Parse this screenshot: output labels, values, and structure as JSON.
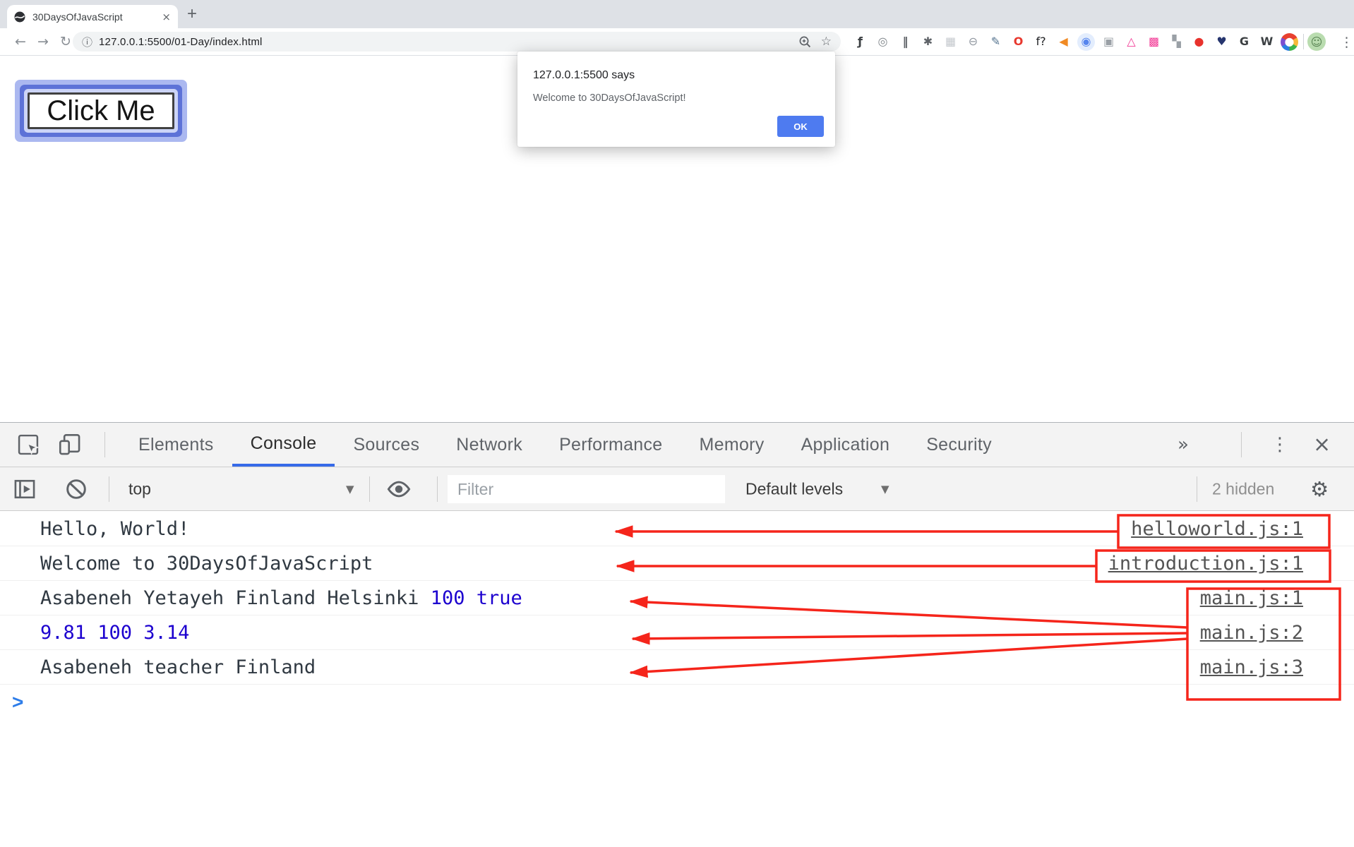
{
  "browser": {
    "tab_title": "30DaysOfJavaScript",
    "close_tab_glyph": "×",
    "new_tab_glyph": "+",
    "back_glyph": "←",
    "forward_glyph": "→",
    "reload_glyph": "↻",
    "info_glyph": "ⓘ",
    "url": "127.0.0.1:5500/01-Day/index.html",
    "star_glyph": "☆",
    "menu_glyph": "⋮",
    "avatar_glyph": "☺",
    "avatar_style": "color:#55804f;background:#b9dcaf",
    "ext_icons": [
      {
        "name": "fn-extension-icon",
        "glyph": "ƒ",
        "color": "#3c4043",
        "bg": "transparent",
        "weight": "bold"
      },
      {
        "name": "target-extension-icon",
        "glyph": "◎",
        "color": "#80868b",
        "bg": "transparent"
      },
      {
        "name": "pause-extension-icon",
        "glyph": "‖",
        "color": "#5f6368",
        "bg": "transparent",
        "weight": "bold"
      },
      {
        "name": "bug-extension-icon",
        "glyph": "✱",
        "color": "#5f6368",
        "bg": "transparent"
      },
      {
        "name": "grid-extension-icon",
        "glyph": "▦",
        "color": "#c3c7cc",
        "bg": "transparent"
      },
      {
        "name": "minus-circle-extension-icon",
        "glyph": "⊖",
        "color": "#9097a0",
        "bg": "transparent"
      },
      {
        "name": "eyedropper-extension-icon",
        "glyph": "✎",
        "color": "#54738f",
        "bg": "transparent"
      },
      {
        "name": "opera-extension-icon",
        "glyph": "O",
        "color": "#e8382e",
        "bg": "transparent",
        "weight": "bold"
      },
      {
        "name": "f-question-extension-icon",
        "glyph": "f?",
        "color": "#202124",
        "bg": "transparent"
      },
      {
        "name": "megaphone-extension-icon",
        "glyph": "◀",
        "color": "#f08a24",
        "bg": "transparent"
      },
      {
        "name": "ring-extension-icon",
        "glyph": "◉",
        "color": "#5585ee",
        "bg": "#e3edfd"
      },
      {
        "name": "camera-extension-icon",
        "glyph": "▣",
        "color": "#9aa0a6",
        "bg": "transparent"
      },
      {
        "name": "triangle-extension-icon",
        "glyph": "△",
        "color": "#f23b96",
        "bg": "transparent",
        "weight": "bold"
      },
      {
        "name": "pink-square-extension-icon",
        "glyph": "▩",
        "color": "#f23b96",
        "bg": "transparent"
      },
      {
        "name": "blocks-extension-icon",
        "glyph": "▚",
        "color": "#9aa0a6",
        "bg": "transparent"
      },
      {
        "name": "red-circle-extension-icon",
        "glyph": "●",
        "color": "#e8322c",
        "bg": "transparent"
      },
      {
        "name": "heart-search-extension-icon",
        "glyph": "♥",
        "color": "#26356e",
        "bg": "transparent"
      },
      {
        "name": "g-extension-icon",
        "glyph": "G",
        "color": "#3c4043",
        "bg": "transparent",
        "weight": "bold"
      },
      {
        "name": "w-extension-icon",
        "glyph": "W",
        "color": "#3c4043",
        "bg": "transparent",
        "weight": "bold"
      },
      {
        "name": "rainbow-extension-icon",
        "glyph": "●",
        "color": "#ffffff",
        "bg": "conic-gradient(#e8402f 0 60deg,#f6b93b 60deg 120deg,#3cb44b 120deg 180deg,#2a7de1 180deg 240deg,#7a4fd0 240deg 300deg,#e8402f 300deg 360deg)"
      }
    ]
  },
  "page": {
    "button_label": "Click Me"
  },
  "dialog": {
    "title": "127.0.0.1:5500 says",
    "message": "Welcome to 30DaysOfJavaScript!",
    "ok_label": "OK"
  },
  "devtools": {
    "tabs": [
      {
        "name": "devtools-tab-elements",
        "label": "Elements"
      },
      {
        "name": "devtools-tab-console",
        "label": "Console",
        "active": true
      },
      {
        "name": "devtools-tab-sources",
        "label": "Sources"
      },
      {
        "name": "devtools-tab-network",
        "label": "Network"
      },
      {
        "name": "devtools-tab-performance",
        "label": "Performance"
      },
      {
        "name": "devtools-tab-memory",
        "label": "Memory"
      },
      {
        "name": "devtools-tab-application",
        "label": "Application"
      },
      {
        "name": "devtools-tab-security",
        "label": "Security"
      }
    ],
    "overflow_glyph": "»",
    "menu_glyph": "⋮",
    "close_glyph": "×",
    "toolbar": {
      "context": "top",
      "caret": "▼",
      "filter_placeholder": "Filter",
      "levels_label": "Default levels",
      "hidden_count": "2 hidden",
      "gear_glyph": "⚙"
    },
    "console": {
      "rows": [
        {
          "plain": "Hello, World!",
          "number": "",
          "link": "helloworld.js:1"
        },
        {
          "plain": "Welcome to 30DaysOfJavaScript",
          "number": "",
          "link": "introduction.js:1"
        },
        {
          "plain": "Asabeneh Yetayeh Finland Helsinki ",
          "number": "100 true",
          "link": "main.js:1"
        },
        {
          "plain": "",
          "number": "9.81 100 3.14",
          "link": "main.js:2"
        },
        {
          "plain": "Asabeneh teacher Finland",
          "number": "",
          "link": "main.js:3"
        }
      ],
      "prompt_glyph": ">"
    }
  },
  "colors": {
    "accent_blue": "#366ae8",
    "number_blue": "#1c00cf",
    "annotation_red": "#f5251b",
    "source_link_gray": "#545454",
    "ok_button_blue": "#4e7bf0"
  }
}
